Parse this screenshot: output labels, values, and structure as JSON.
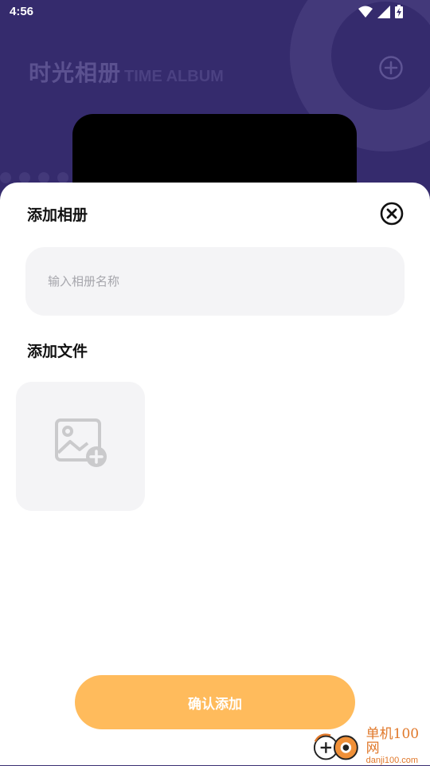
{
  "status_bar": {
    "time": "4:56",
    "icons": [
      "wifi-icon",
      "signal-icon",
      "battery-charging-icon"
    ]
  },
  "header": {
    "title_cn": "时光相册",
    "title_en": "TIME ALBUM",
    "add_icon": "plus-circle-icon"
  },
  "sheet": {
    "title": "添加相册",
    "close_icon": "close-circle-icon",
    "name_input": {
      "value": "",
      "placeholder": "输入相册名称"
    },
    "files_label": "添加文件",
    "add_file_icon": "image-add-icon",
    "confirm_label": "确认添加"
  },
  "watermark": {
    "main": "单机100网",
    "sub": "danji100.com"
  },
  "colors": {
    "header_bg": "#352b6d",
    "accent_button": "#ffbb5c",
    "input_bg": "#f4f4f6",
    "watermark": "#e0782a"
  }
}
